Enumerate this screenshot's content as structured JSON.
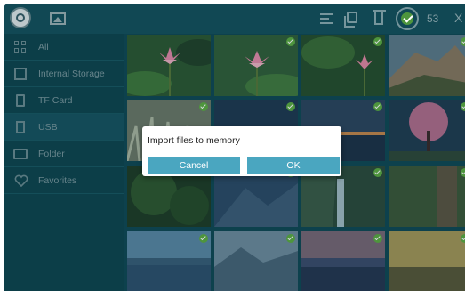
{
  "toolbar": {
    "icons": [
      "avatar-icon",
      "gallery-icon",
      "list-icon",
      "copy-icon",
      "trash-icon",
      "select-all-icon",
      "close-icon"
    ],
    "selected_count": "53",
    "close_label": "X"
  },
  "sidebar": {
    "items": [
      {
        "label": "All",
        "icon": "grid-icon"
      },
      {
        "label": "Internal Storage",
        "icon": "storage-icon"
      },
      {
        "label": "TF Card",
        "icon": "sd-card-icon"
      },
      {
        "label": "USB",
        "icon": "usb-icon"
      },
      {
        "label": "Folder",
        "icon": "folder-icon"
      },
      {
        "label": "Favorites",
        "icon": "heart-icon"
      }
    ],
    "active_index": 3
  },
  "grid": {
    "thumbnails": [
      {
        "subject": "lotus",
        "selected": false
      },
      {
        "subject": "lotus",
        "selected": true
      },
      {
        "subject": "lotus",
        "selected": true
      },
      {
        "subject": "rocky hill",
        "selected": true
      },
      {
        "subject": "grass",
        "selected": true
      },
      {
        "subject": "blue hills",
        "selected": true
      },
      {
        "subject": "sunset sea",
        "selected": true
      },
      {
        "subject": "pink tree",
        "selected": true
      },
      {
        "subject": "forest",
        "selected": true
      },
      {
        "subject": "mountain",
        "selected": true
      },
      {
        "subject": "waterfall",
        "selected": true
      },
      {
        "subject": "tree trunk",
        "selected": true
      },
      {
        "subject": "lake",
        "selected": true
      },
      {
        "subject": "mountain lake",
        "selected": true
      },
      {
        "subject": "harbor sunset",
        "selected": true
      },
      {
        "subject": "sunset",
        "selected": true
      }
    ]
  },
  "dialog": {
    "title": "Import files to memory",
    "cancel_label": "Cancel",
    "ok_label": "OK"
  },
  "colors": {
    "background": "#0f4a56",
    "accent": "#4aa6c0",
    "check": "#5fb043"
  }
}
